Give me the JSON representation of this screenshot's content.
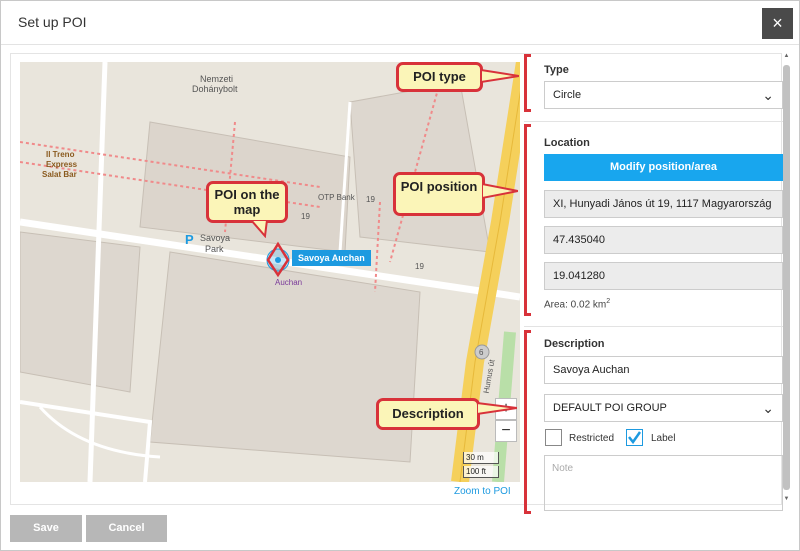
{
  "dialog": {
    "title": "Set up POI",
    "close_icon": "×"
  },
  "map": {
    "poi_label": "Savoya Auchan",
    "labels": {
      "nemzeti": "Nemzeti",
      "dohanybolt": "Dohánybolt",
      "treno1": "Il Treno",
      "treno2": "Express",
      "treno3": "Salat Bar",
      "otp": "OTP Bank",
      "savoya": "Savoya",
      "park": "Park",
      "auchan": "Auchan",
      "num19a": "19",
      "num19b": "19",
      "num19c": "19",
      "road": "Hunyadi János út",
      "road2": "Humus út",
      "road_num": "6"
    },
    "parking_icon": "P",
    "zoom_in": "+",
    "zoom_out": "−",
    "scale_m": "30 m",
    "scale_ft": "100 ft",
    "zoom_link": "Zoom to POI"
  },
  "callouts": {
    "poi_type": "POI type",
    "poi_on_map": "POI on the map",
    "poi_position": "POI position",
    "description": "Description"
  },
  "panel": {
    "type_label": "Type",
    "type_value": "Circle",
    "location_label": "Location",
    "modify_button": "Modify position/area",
    "address": "XI, Hunyadi János út 19, 1117 Magyarország",
    "latitude": "47.435040",
    "longitude": "19.041280",
    "area_prefix": "Area: 0.02 km",
    "area_sup": "2",
    "description_label": "Description",
    "description_value": "Savoya Auchan",
    "group_value": "DEFAULT POI GROUP",
    "restricted_label": "Restricted",
    "restricted_checked": false,
    "label_label": "Label",
    "label_checked": true,
    "note_placeholder": "Note"
  },
  "footer": {
    "save_label": "Save",
    "cancel_label": "Cancel"
  },
  "colors": {
    "accent": "#18a6ee",
    "callout_border": "#d8323a",
    "callout_fill": "#fbf5b8",
    "disabled_button": "#b7b7b7"
  }
}
